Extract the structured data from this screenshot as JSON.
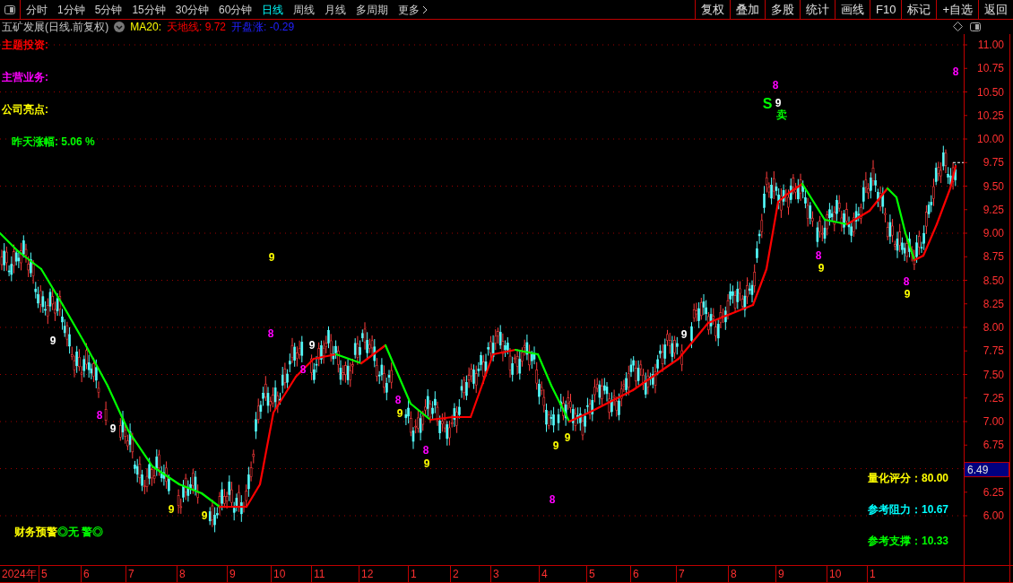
{
  "toolbar": {
    "periods": [
      {
        "label": "分时",
        "selected": false
      },
      {
        "label": "1分钟",
        "selected": false
      },
      {
        "label": "5分钟",
        "selected": false
      },
      {
        "label": "15分钟",
        "selected": false
      },
      {
        "label": "30分钟",
        "selected": false
      },
      {
        "label": "60分钟",
        "selected": false
      },
      {
        "label": "日线",
        "selected": true
      },
      {
        "label": "周线",
        "selected": false
      },
      {
        "label": "月线",
        "selected": false
      },
      {
        "label": "多周期",
        "selected": false
      }
    ],
    "more": "更多",
    "actions": [
      "复权",
      "叠加",
      "多股",
      "统计",
      "画线",
      "F10",
      "标记",
      "+自选",
      "返回"
    ]
  },
  "title_row": {
    "stock": "五矿发展(日线.前复权)",
    "indicators": [
      {
        "text": "MA20:",
        "color": "#ffff00"
      },
      {
        "text": "天地线: 9.72",
        "color": "#ff0000"
      },
      {
        "text": "开盘涨: -0.29",
        "color": "#2020ff"
      }
    ]
  },
  "info_labels": [
    {
      "text": "主题投资:",
      "color": "#ff0000"
    },
    {
      "text": "主营业务:",
      "color": "#ff00ff"
    },
    {
      "text": "公司亮点:",
      "color": "#ffff00"
    },
    {
      "text": "昨天涨幅: 5.06 %",
      "color": "#00ff00"
    }
  ],
  "warning": {
    "label": "财务预警",
    "value": "◎无 警◎"
  },
  "scores": [
    {
      "text": "量化评分：80.00",
      "color": "#ffff00"
    },
    {
      "text": "参考阻力：10.67",
      "color": "#00ffff"
    },
    {
      "text": "参考支撑：10.33",
      "color": "#00ff00"
    }
  ],
  "signal_marks": [
    {
      "text": "9",
      "color": "#ffffff"
    },
    {
      "text": "8",
      "color": "#ff00ff"
    },
    {
      "text": "9",
      "color": "#ffffff"
    },
    {
      "text": "9",
      "color": "#ffff00"
    },
    {
      "text": "9",
      "color": "#ffff00"
    },
    {
      "text": "9",
      "color": "#ffff00"
    },
    {
      "text": "8",
      "color": "#ff00ff"
    },
    {
      "text": "9",
      "color": "#ffffff"
    },
    {
      "text": "8",
      "color": "#ff00ff"
    },
    {
      "text": "8",
      "color": "#ff00ff"
    },
    {
      "text": "9",
      "color": "#ffff00"
    },
    {
      "text": "8",
      "color": "#ff00ff"
    },
    {
      "text": "9",
      "color": "#ffff00"
    },
    {
      "text": "8",
      "color": "#ff00ff"
    },
    {
      "text": "9",
      "color": "#ffff00"
    },
    {
      "text": "9",
      "color": "#ffff00"
    },
    {
      "text": "9",
      "color": "#ffffff"
    },
    {
      "text": "S",
      "color": "#00ff00"
    },
    {
      "text": "8",
      "color": "#ff00ff"
    },
    {
      "text": "9",
      "color": "#ffffff"
    },
    {
      "text": "卖",
      "color": "#00ff00"
    },
    {
      "text": "8",
      "color": "#ff00ff"
    },
    {
      "text": "9",
      "color": "#ffff00"
    },
    {
      "text": "8",
      "color": "#ff00ff"
    },
    {
      "text": "9",
      "color": "#ffff00"
    },
    {
      "text": "8",
      "color": "#ff00ff"
    }
  ],
  "price_axis": [
    "11.00",
    "10.75",
    "10.50",
    "10.25",
    "10.00",
    "9.75",
    "9.50",
    "9.25",
    "9.00",
    "8.75",
    "8.50",
    "8.25",
    "8.00",
    "7.75",
    "7.50",
    "7.25",
    "7.00",
    "6.75",
    "6.25",
    "6.00"
  ],
  "last_price": "6.49",
  "time_axis": [
    "2024年",
    "5",
    "6",
    "7",
    "8",
    "9",
    "10",
    "11",
    "12",
    "1",
    "2",
    "3",
    "4",
    "5",
    "6",
    "7",
    "8",
    "9",
    "10",
    "1"
  ]
}
